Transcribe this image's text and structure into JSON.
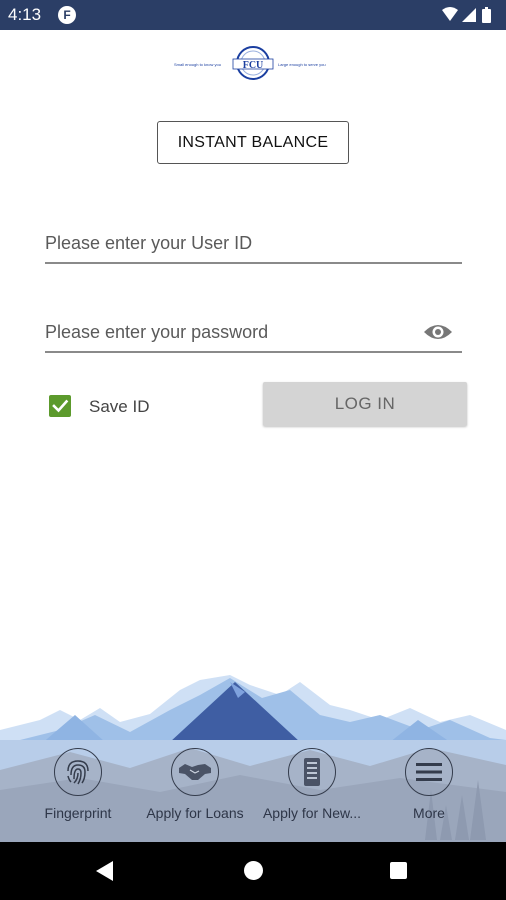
{
  "status_bar": {
    "time": "4:13",
    "notification_icon": "f-badge-icon",
    "icons": [
      "wifi-icon",
      "signal-icon",
      "battery-icon"
    ]
  },
  "logo": {
    "text": "FCU",
    "left_tagline": "Small enough to know you",
    "right_tagline": "Large enough to serve you"
  },
  "instant_balance_label": "INSTANT BALANCE",
  "user_id": {
    "value": "",
    "placeholder": "Please enter your User ID"
  },
  "password": {
    "value": "",
    "placeholder": "Please enter your password",
    "toggle_icon": "eye-icon"
  },
  "save_id": {
    "label": "Save ID",
    "checked": true
  },
  "login_label": "LOG IN",
  "dock": {
    "items": [
      {
        "label": "Fingerprint",
        "icon": "fingerprint-icon"
      },
      {
        "label": "Apply for Loans",
        "icon": "handshake-icon"
      },
      {
        "label": "Apply for New...",
        "icon": "phone-icon"
      },
      {
        "label": "More",
        "icon": "menu-icon"
      }
    ]
  },
  "nav_bar": {
    "icons": [
      "back-icon",
      "home-icon",
      "recents-icon"
    ]
  },
  "colors": {
    "status_bar": "#2b3e66",
    "checkbox": "#5c9a2c",
    "login_button": "#d4d4d4",
    "mountain_dark": "#3f5ea3",
    "mountain_light": "#8fb4e3"
  }
}
